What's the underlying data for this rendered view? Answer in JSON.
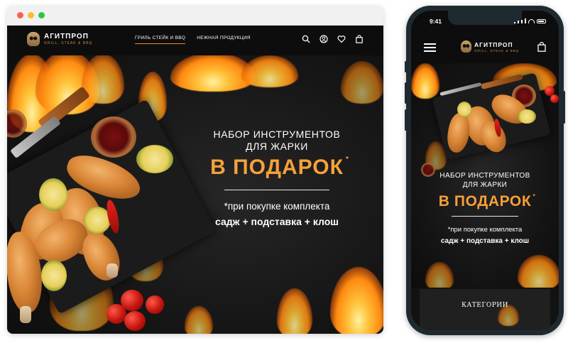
{
  "desktop": {
    "logo": {
      "name": "АГИТПРОП",
      "tagline": "GRILL, STEAK & BBQ"
    },
    "nav": [
      {
        "label": "ГРИЛЬ СТЕЙК И BBQ",
        "active": true
      },
      {
        "label": "НЕЖНАЯ ПРОДУКЦИЯ",
        "active": false
      }
    ],
    "header_icons": [
      "search-icon",
      "user-icon",
      "heart-icon",
      "shopping-bag-icon"
    ],
    "promo": {
      "title_line1": "НАБОР ИНСТРУМЕНТОВ",
      "title_line2": "ДЛЯ ЖАРКИ",
      "gift": "В ПОДАРОК",
      "asterisk": "*",
      "condition": "*при покупке комплекта",
      "items": "садж + подставка  + клош"
    }
  },
  "mobile": {
    "time": "9:41",
    "logo": {
      "name": "АГИТПРОП",
      "tagline": "GRILL, STEAK & BBQ"
    },
    "promo": {
      "title_line1": "НАБОР ИНСТРУМЕНТОВ",
      "title_line2": "ДЛЯ ЖАРКИ",
      "gift": "В ПОДАРОК",
      "asterisk": "*",
      "condition": "*при покупке комплекта",
      "items": "садж + подставка  + клош"
    },
    "categories_label": "КАТЕГОРИИ"
  },
  "colors": {
    "accent": "#f7a03a",
    "nav_underline": "#f28a1c",
    "background": "#151515",
    "header": "#0d0d0d",
    "phone_frame": "#1e2a30"
  }
}
